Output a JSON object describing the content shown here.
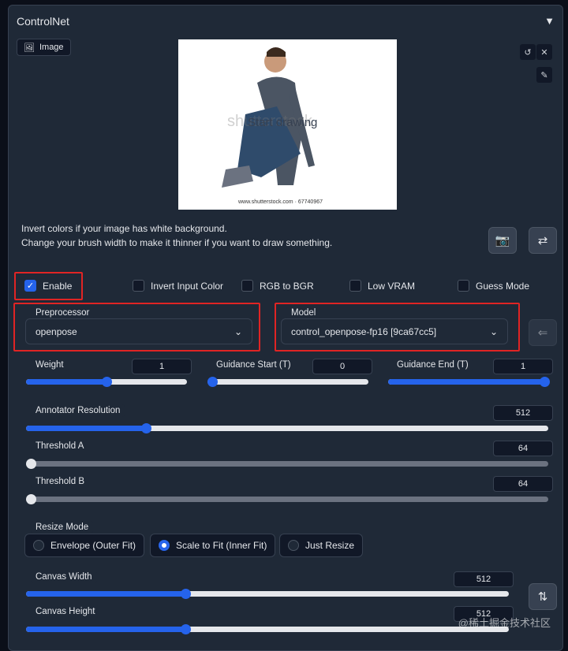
{
  "title": "ControlNet",
  "image_tab": "Image",
  "canvas": {
    "overlay": "Start drawing",
    "watermark": "shutterstock",
    "watermark_url": "www.shutterstock.com · 67740967"
  },
  "hint": {
    "line1": "Invert colors if your image has white background.",
    "line2": "Change your brush width to make it thinner if you want to draw something."
  },
  "checkboxes": [
    {
      "label": "Enable",
      "checked": true
    },
    {
      "label": "Invert Input Color",
      "checked": false
    },
    {
      "label": "RGB to BGR",
      "checked": false
    },
    {
      "label": "Low VRAM",
      "checked": false
    },
    {
      "label": "Guess Mode",
      "checked": false
    }
  ],
  "preprocessor": {
    "label": "Preprocessor",
    "value": "openpose"
  },
  "model": {
    "label": "Model",
    "value": "control_openpose-fp16 [9ca67cc5]"
  },
  "sliders": {
    "weight": {
      "label": "Weight",
      "value": "1",
      "fraction": 0.5
    },
    "guidance_start": {
      "label": "Guidance Start (T)",
      "value": "0",
      "fraction": 0
    },
    "guidance_end": {
      "label": "Guidance End (T)",
      "value": "1",
      "fraction": 1
    },
    "annotator": {
      "label": "Annotator Resolution",
      "value": "512",
      "fraction": 0.23
    },
    "threshold_a": {
      "label": "Threshold A",
      "value": "64",
      "fraction": 0
    },
    "threshold_b": {
      "label": "Threshold B",
      "value": "64",
      "fraction": 0
    },
    "canvas_width": {
      "label": "Canvas Width",
      "value": "512",
      "fraction": 0.33
    },
    "canvas_height": {
      "label": "Canvas Height",
      "value": "512",
      "fraction": 0.33
    }
  },
  "resize_mode": {
    "label": "Resize Mode",
    "options": [
      "Envelope (Outer Fit)",
      "Scale to Fit (Inner Fit)",
      "Just Resize"
    ],
    "selected": 1
  },
  "corner_watermark": "@稀土掘金技术社区",
  "colors": {
    "accent": "#2563eb",
    "highlight": "#e02424",
    "panel": "#1f2937"
  }
}
